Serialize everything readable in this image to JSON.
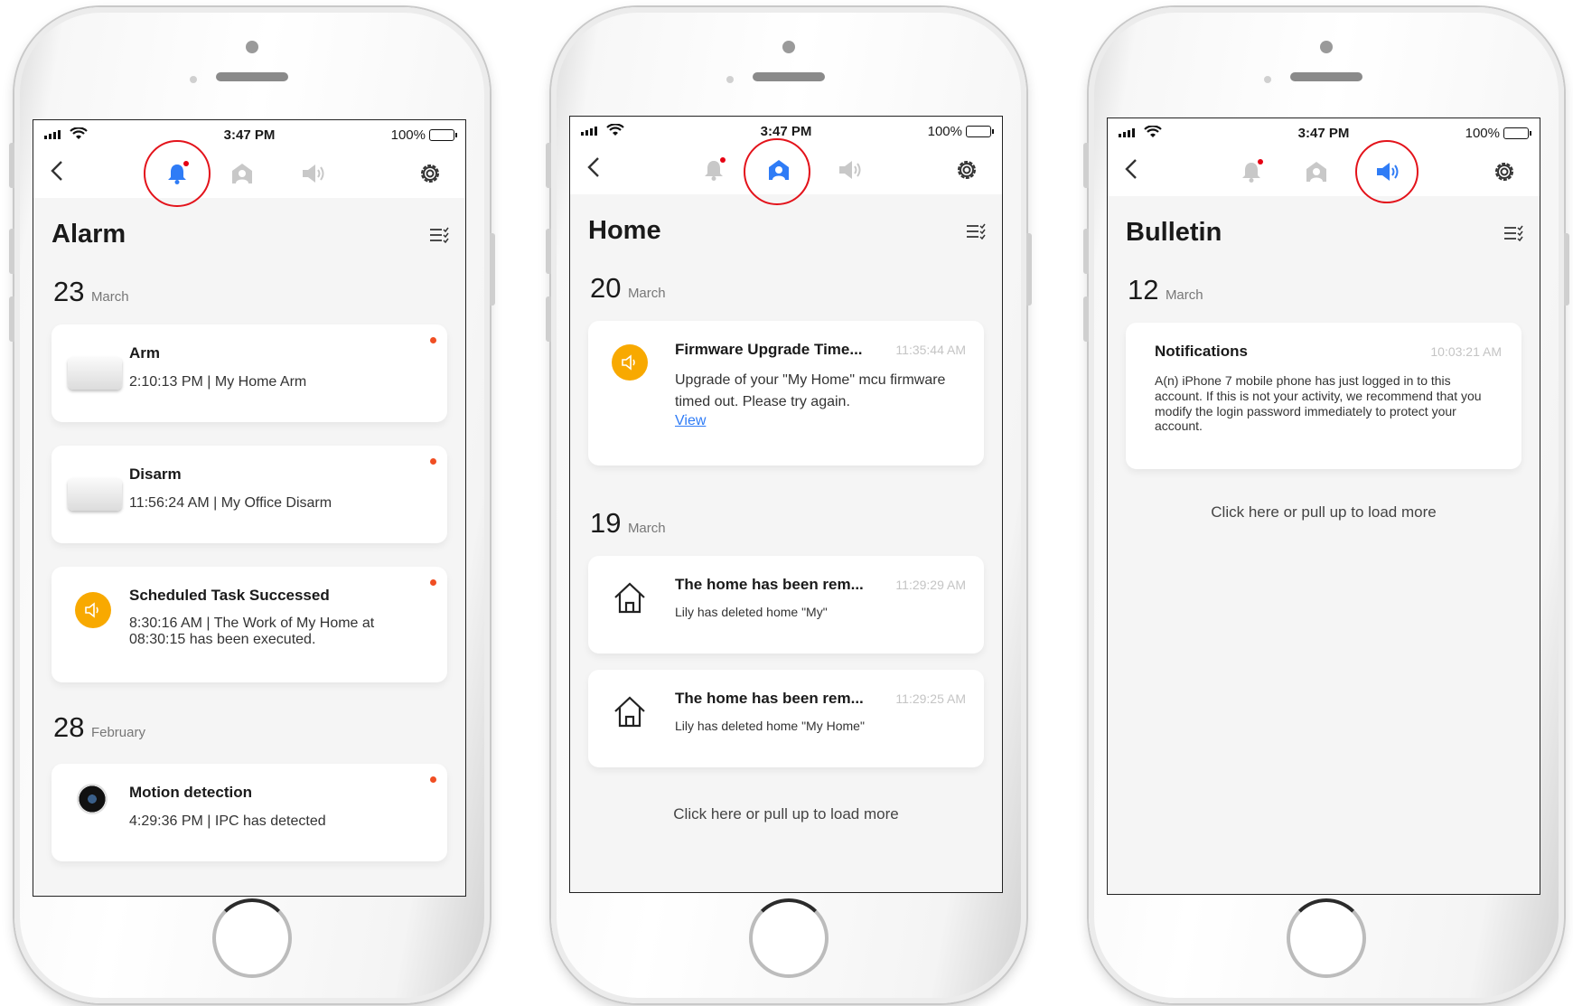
{
  "phones": [
    {
      "status": {
        "time": "3:47 PM",
        "battery": "100%"
      },
      "section_title": "Alarm",
      "groups": [
        {
          "day": "23",
          "month": "March",
          "items": [
            {
              "title": "Arm",
              "detail": "2:10:13 PM | My Home Arm",
              "icon": "alarm-hub-device-image"
            },
            {
              "title": "Disarm",
              "detail": "11:56:24 AM | My Office Disarm",
              "icon": "alarm-hub-device-image"
            },
            {
              "title": "Scheduled Task Successed",
              "detail": "8:30:16 AM | The Work of My Home at 08:30:15 has been executed.",
              "icon": "speaker-icon"
            }
          ]
        },
        {
          "day": "28",
          "month": "February",
          "items": [
            {
              "title": "Motion detection",
              "detail": "4:29:36 PM | IPC has detected",
              "icon": "camera-device-image"
            }
          ]
        }
      ]
    },
    {
      "status": {
        "time": "3:47 PM",
        "battery": "100%"
      },
      "section_title": "Home",
      "groups": [
        {
          "day": "20",
          "month": "March",
          "items": [
            {
              "title": "Firmware Upgrade Time...",
              "time": "11:35:44 AM",
              "detail": "Upgrade of your \"My Home\" mcu firmware timed out. Please try again.",
              "link": "View",
              "icon": "speaker-icon"
            }
          ]
        },
        {
          "day": "19",
          "month": "March",
          "items": [
            {
              "title": "The home has been rem...",
              "time": "11:29:29 AM",
              "detail": "Lily has deleted home \"My\"",
              "icon": "house-icon"
            },
            {
              "title": "The home has been rem...",
              "time": "11:29:25 AM",
              "detail": "Lily has deleted home \"My Home\"",
              "icon": "house-icon"
            }
          ]
        }
      ],
      "load_more": "Click here or pull up to load more"
    },
    {
      "status": {
        "time": "3:47 PM",
        "battery": "100%"
      },
      "section_title": "Bulletin",
      "groups": [
        {
          "day": "12",
          "month": "March",
          "items": [
            {
              "title": "Notifications",
              "time": "10:03:21 AM",
              "detail": "A(n) iPhone 7 mobile phone has just logged in to this account. If this is not your activity, we recommend that you modify the login password immediately to protect your account."
            }
          ]
        }
      ],
      "load_more": "Click here or pull up to load more"
    }
  ],
  "colors": {
    "accent_blue": "#2f7cf6",
    "icon_gray": "#c8c8c8",
    "unread_dot": "#f04e23",
    "highlight_ring": "#e3131b",
    "speaker_orange": "#f8a900",
    "link_blue": "#2f7cf6"
  },
  "active_tabs": [
    "alarm-tab",
    "home-tab",
    "bulletin-tab"
  ]
}
